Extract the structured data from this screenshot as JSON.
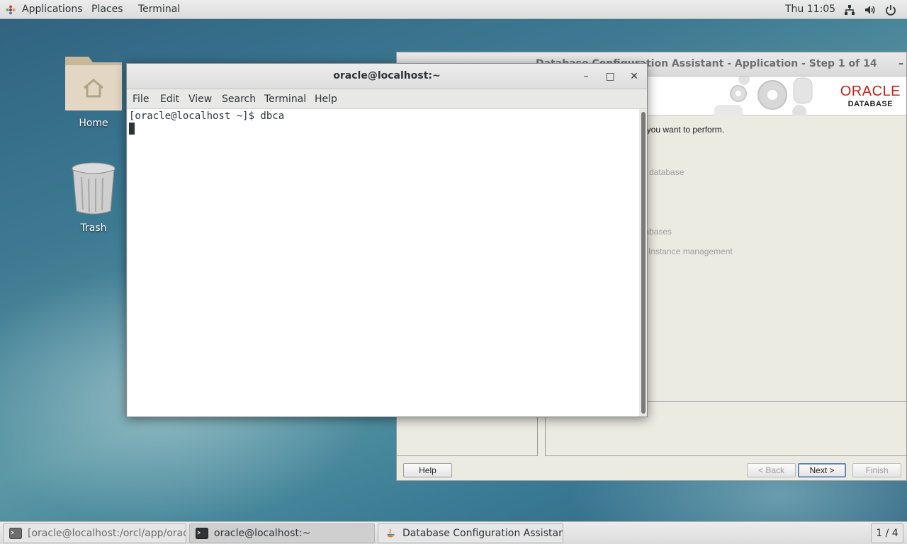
{
  "topbar": {
    "applications": "Applications",
    "places": "Places",
    "terminal": "Terminal",
    "clock": "Thu 11:05",
    "icons": [
      "network-icon",
      "volume-icon",
      "power-icon"
    ]
  },
  "desktop": {
    "home_label": "Home",
    "trash_label": "Trash"
  },
  "dbca": {
    "title": "Database Configuration Assistant - Application - Step 1 of 14",
    "min_glyph": "–",
    "logo_oracle": "ORACLE",
    "logo_database": "DATABASE",
    "prompt": "t you want to perform.",
    "opt_database": "database",
    "opt_tabases": "tabases",
    "opt_instance": "Instance management",
    "help": "Help",
    "back": "< Back",
    "next": "Next >",
    "finish": "Finish"
  },
  "terminal": {
    "title": "oracle@localhost:~",
    "min_glyph": "–",
    "max_glyph": "□",
    "close_glyph": "✕",
    "menu": [
      "File",
      "Edit",
      "View",
      "Search",
      "Terminal",
      "Help"
    ],
    "line1": "[oracle@localhost ~]$ dbca"
  },
  "taskbar": {
    "task1": "[oracle@localhost:/orcl/app/oracle/d...",
    "task2": "oracle@localhost:~",
    "task3": "Database Configuration Assistant - A...",
    "workspace": "1 / 4"
  },
  "colors": {
    "oracle_red": "#c5201e",
    "panel": "#e8e8e7",
    "dbca_bg": "#ecebe2"
  }
}
